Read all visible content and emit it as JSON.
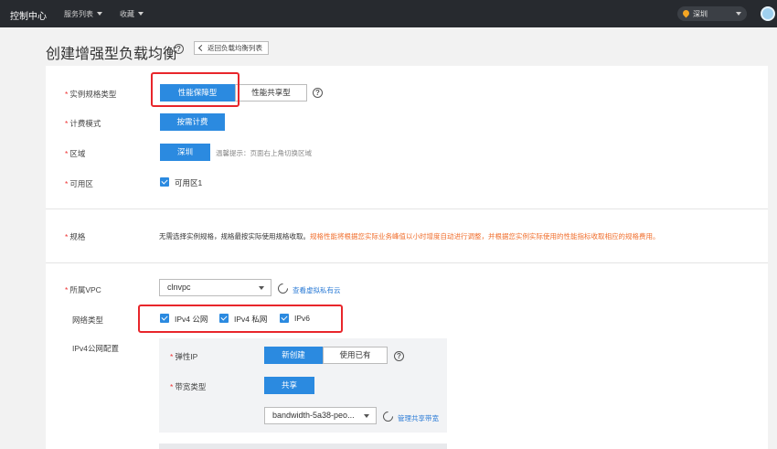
{
  "nav": {
    "brand": "控制中心",
    "menu_services": "服务列表",
    "menu_favorites": "收藏",
    "region": "深圳"
  },
  "header": {
    "title": "创建增强型负载均衡",
    "back_label": "返回负载均衡列表"
  },
  "form": {
    "instance_type": {
      "label": "实例规格类型",
      "options": [
        "性能保障型",
        "性能共享型"
      ],
      "selected": "性能保障型"
    },
    "billing": {
      "label": "计费模式",
      "value": "按需计费"
    },
    "region": {
      "label": "区域",
      "value": "深圳",
      "hint": "温馨提示：页面右上角切换区域"
    },
    "az": {
      "label": "可用区",
      "option": "可用区1"
    },
    "spec": {
      "label": "规格",
      "text": "无需选择实例规格，规格最按实际使用规格收取。",
      "warn": "规格性能将根据您实际业务峰值以小时增度自动进行调整，并根据您实例实际使用的性能指标收取相应的规格费用。"
    },
    "vpc": {
      "label": "所属VPC",
      "value": "clnvpc",
      "link": "查看虚拟私有云"
    },
    "network_type": {
      "label": "网络类型",
      "options": [
        "IPv4 公网",
        "IPv4 私网",
        "IPv6"
      ]
    },
    "ipv4_public": {
      "label": "IPv4公网配置",
      "eip": {
        "label": "弹性IP",
        "options": [
          "新创建",
          "使用已有"
        ],
        "selected": "新创建"
      },
      "bandwidth_type": {
        "label": "带宽类型",
        "value": "共享"
      },
      "bandwidth": {
        "value": "bandwidth-5a38-peo...",
        "link": "管理共享带宽"
      }
    }
  },
  "colors": {
    "primary": "#2b8ae0",
    "highlight": "#e8262b",
    "warning": "#f06d2b",
    "topbar": "#272a2f"
  }
}
